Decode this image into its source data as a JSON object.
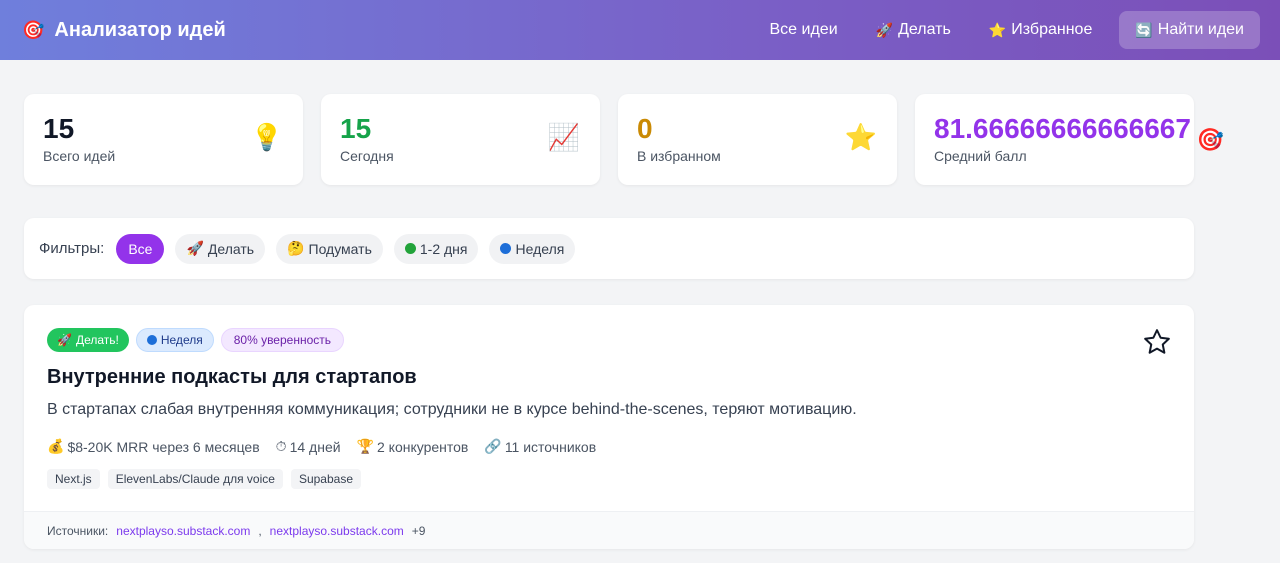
{
  "header": {
    "logo_icon": "🎯",
    "title": "Анализатор идей",
    "nav": [
      {
        "icon": "",
        "label": "Все идеи"
      },
      {
        "icon": "🚀",
        "label": "Делать"
      },
      {
        "icon": "⭐",
        "label": "Избранное"
      },
      {
        "icon": "🔄",
        "label": "Найти идеи"
      }
    ]
  },
  "stats": [
    {
      "value": "15",
      "label": "Всего идей",
      "icon": "💡",
      "color": "#111827"
    },
    {
      "value": "15",
      "label": "Сегодня",
      "icon": "📈",
      "color": "#16a34a"
    },
    {
      "value": "0",
      "label": "В избранном",
      "icon": "⭐",
      "color": "#ca8a04"
    },
    {
      "value": "81.66666666666667",
      "label": "Средний балл",
      "icon": "🎯",
      "color": "#9333ea"
    }
  ],
  "filters": {
    "label": "Фильтры:",
    "chips": [
      {
        "icon": "",
        "label": "Все",
        "active": true
      },
      {
        "icon": "🚀",
        "label": "Делать"
      },
      {
        "icon": "🤔",
        "label": "Подумать"
      },
      {
        "icon": "green-dot",
        "label": "1-2 дня"
      },
      {
        "icon": "blue-dot",
        "label": "Неделя"
      }
    ]
  },
  "idea": {
    "tags": [
      {
        "icon": "🚀",
        "label": "Делать!"
      },
      {
        "icon": "blue-dot",
        "label": "Неделя"
      },
      {
        "icon": "",
        "label": "80% уверенность"
      }
    ],
    "title": "Внутренние подкасты для стартапов",
    "description": "В стартапах слабая внутренняя коммуникация; сотрудники не в курсе behind-the-scenes, теряют мотивацию.",
    "metrics": [
      {
        "icon": "💰",
        "label": "$8-20K MRR через 6 месяцев"
      },
      {
        "icon": "⏱",
        "label": "14 дней"
      },
      {
        "icon": "🏆",
        "label": "2 конкурентов"
      },
      {
        "icon": "🔗",
        "label": "11 источников"
      }
    ],
    "tech": [
      "Next.js",
      "ElevenLabs/Claude для voice",
      "Supabase"
    ],
    "sources": {
      "label": "Источники:",
      "links": [
        "nextplayso.substack.com",
        "nextplayso.substack.com"
      ],
      "separator": ",",
      "more": "+9"
    }
  },
  "colors": {
    "accent": "#9333ea",
    "header_gradient_start": "#6f7fdc",
    "header_gradient_end": "#7b4fb8"
  }
}
